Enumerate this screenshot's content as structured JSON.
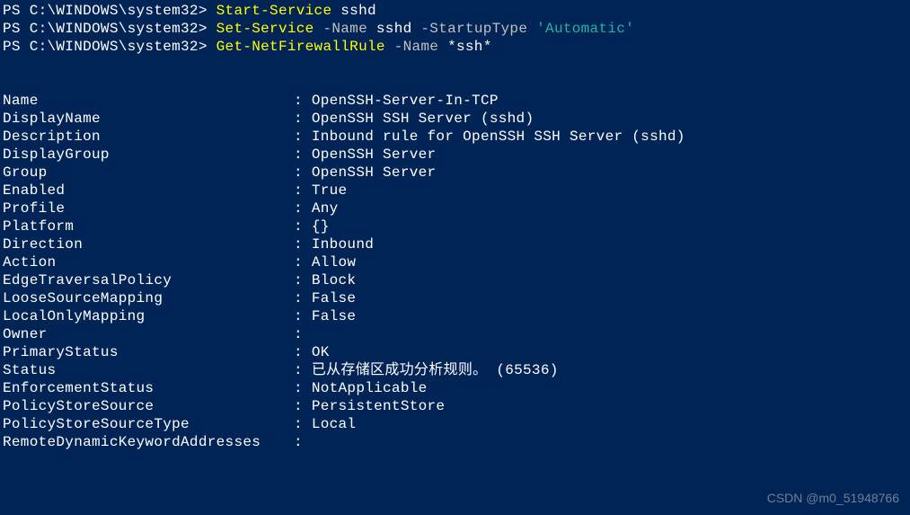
{
  "terminal": {
    "prompt": "PS C:\\WINDOWS\\system32> ",
    "commands": [
      {
        "cmdlet": "Start-Service",
        "segments": [
          {
            "text": " sshd",
            "cls": "arg-white"
          }
        ]
      },
      {
        "cmdlet": "Set-Service",
        "segments": [
          {
            "text": " -Name",
            "cls": "param"
          },
          {
            "text": " sshd ",
            "cls": "arg-white"
          },
          {
            "text": "-StartupType",
            "cls": "param"
          },
          {
            "text": " 'Automatic'",
            "cls": "arg-cyan"
          }
        ]
      },
      {
        "cmdlet": "Get-NetFirewallRule",
        "segments": [
          {
            "text": " -Name",
            "cls": "param"
          },
          {
            "text": " *ssh*",
            "cls": "arg-white"
          }
        ]
      }
    ],
    "blank_lines_after_cmds": 2,
    "output": [
      {
        "key": "Name",
        "value": "OpenSSH-Server-In-TCP"
      },
      {
        "key": "DisplayName",
        "value": "OpenSSH SSH Server (sshd)"
      },
      {
        "key": "Description",
        "value": "Inbound rule for OpenSSH SSH Server (sshd)"
      },
      {
        "key": "DisplayGroup",
        "value": "OpenSSH Server"
      },
      {
        "key": "Group",
        "value": "OpenSSH Server"
      },
      {
        "key": "Enabled",
        "value": "True"
      },
      {
        "key": "Profile",
        "value": "Any"
      },
      {
        "key": "Platform",
        "value": "{}"
      },
      {
        "key": "Direction",
        "value": "Inbound"
      },
      {
        "key": "Action",
        "value": "Allow"
      },
      {
        "key": "EdgeTraversalPolicy",
        "value": "Block"
      },
      {
        "key": "LooseSourceMapping",
        "value": "False"
      },
      {
        "key": "LocalOnlyMapping",
        "value": "False"
      },
      {
        "key": "Owner",
        "value": ""
      },
      {
        "key": "PrimaryStatus",
        "value": "OK"
      },
      {
        "key": "Status",
        "value": "已从存储区成功分析规则。 (65536)"
      },
      {
        "key": "EnforcementStatus",
        "value": "NotApplicable"
      },
      {
        "key": "PolicyStoreSource",
        "value": "PersistentStore"
      },
      {
        "key": "PolicyStoreSourceType",
        "value": "Local"
      },
      {
        "key": "RemoteDynamicKeywordAddresses",
        "value": ""
      }
    ]
  },
  "watermark": "CSDN @m0_51948766"
}
